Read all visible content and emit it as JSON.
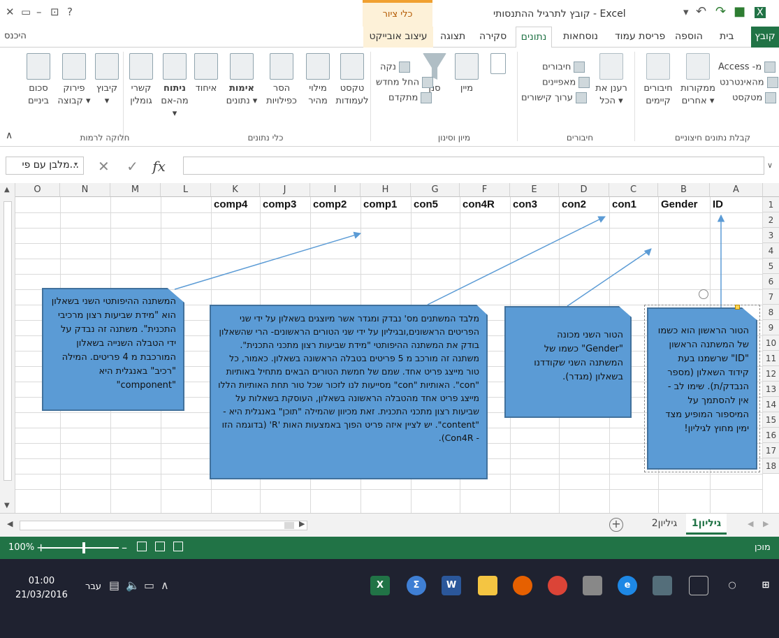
{
  "window": {
    "title": "קובץ לתרגיל ההתנסותי - Excel",
    "context_tool": "כלי ציור",
    "help": "?",
    "signin": "היכנס"
  },
  "tabs": {
    "file": "קובץ",
    "home": "בית",
    "insert": "הוספה",
    "page_layout": "פריסת עמוד",
    "formulas": "נוסחאות",
    "data": "נתונים",
    "review": "סקירה",
    "view": "תצוגה",
    "format": "עיצוב אובייקט"
  },
  "ribbon": {
    "get_external": {
      "label": "קבלת נתונים חיצוניים",
      "access": "Access -מ",
      "web": "מהאינטרנט",
      "text": "מטקסט",
      "other_sources_1": "ממקורות",
      "other_sources_2": "אחרים ▾",
      "existing_1": "חיבורים",
      "existing_2": "קיימים"
    },
    "connections": {
      "label": "חיבורים",
      "refresh_1": "רענן את",
      "refresh_2": "הכל ▾",
      "connections": "חיבורים",
      "properties": "מאפיינים",
      "edit_links": "ערוך קישורים"
    },
    "sort_filter": {
      "label": "מיון וסינון",
      "sort": "מיין",
      "filter": "סנן",
      "clear": "נקה",
      "reapply": "החל מחדש",
      "advanced": "מתקדם"
    },
    "data_tools": {
      "label": "כלי נתונים",
      "text_to_columns_1": "טקסט",
      "text_to_columns_2": "לעמודות",
      "flash_fill_1": "מילוי",
      "flash_fill_2": "מהיר",
      "remove_dup_1": "הסר",
      "remove_dup_2": "כפילויות",
      "validation_1": "אימות",
      "validation_2": "נתונים ▾",
      "consolidate": "איחוד",
      "whatif_1": "ניתוח",
      "whatif_2": "מה-אם ▾",
      "relationships_1": "קשרי",
      "relationships_2": "גומלין"
    },
    "outline": {
      "label": "חלוקה לרמות",
      "group_1": "קיבוץ",
      "group_2": "▾",
      "ungroup_1": "פירוק",
      "ungroup_2": "קבוצה ▾",
      "subtotal_1": "סכום",
      "subtotal_2": "ביניים"
    }
  },
  "formula_bar": {
    "name_box": "מלבן עם פי...",
    "fx": "fx",
    "value": ""
  },
  "columns": [
    "A",
    "B",
    "C",
    "D",
    "E",
    "F",
    "G",
    "H",
    "I",
    "J",
    "K",
    "L",
    "M",
    "N",
    "O"
  ],
  "rows": [
    "1",
    "2",
    "3",
    "4",
    "5",
    "6",
    "7",
    "8",
    "9",
    "10",
    "11",
    "12",
    "13",
    "14",
    "15",
    "16",
    "17",
    "18"
  ],
  "header_cells": {
    "A": "ID",
    "B": "Gender",
    "C": "con1",
    "D": "con2",
    "E": "con3",
    "F": "con4R",
    "G": "con5",
    "H": "comp1",
    "I": "comp2",
    "J": "comp3",
    "K": "comp4"
  },
  "callouts": {
    "id_note": "הטור הראשון הוא כשמו של המשתנה הראשון \"ID\" שרשמנו בעת קידוד השאלון (מספר הנבדק/ת). שימו לב - אין להסתמך על המיספור המופיע מצד ימין מחוץ לגיליון!",
    "gender_note": "הטור השני מכונה \"Gender\" כשמו של המשתנה השני שקודדנו בשאלון (מגדר).",
    "con_note": "מלבד המשתנים מס' נבדק ומגדר אשר מיוצגים בשאלון על ידי שני הפריטים הראשונים,ובגיליון על ידי שני הטורים הראשונים- הרי שהשאלון בודק את המשתנה ההיפותטי \"מידת שביעות רצון מתכני התכנית\". משתנה זה מורכב מ 5 פריטים בטבלה הראשונה בשאלון. כאמור, כל טור מייצג פריט אחד. שמם של חמשת הטורים הבאים מתחיל באותיות \"con\". האותיות \"con\" מסייעות לנו לזכור שכל טור תחת האותיות הללו מייצג פריט אחד מהטבלה הראשונה בשאלון, העוסקת בשאלות על שביעות רצון מתכני התכנית. זאת מכיוון שהמילה \"תוכן\" באנגלית היא - \"content\". יש לציין איזה פריט הפוך באמצעות האות 'R' (בדוגמה הזו - Con4R).",
    "comp_note": "המשתנה ההיפותטי השני בשאלון הוא \"מידת שביעות רצון מרכיבי התכנית\". משתנה זה נבדק על ידי הטבלה השנייה בשאלון המורכבת מ 4 פריטים. המילה \"רכיב\" באנגלית היא \"component\""
  },
  "sheets": {
    "sheet1": "גיליון1",
    "sheet2": "גיליון2",
    "add": "+"
  },
  "status": {
    "ready": "מוכן",
    "zoom": "100%"
  },
  "taskbar": {
    "time": "01:00",
    "date": "21/03/2016",
    "lang": "עבר"
  },
  "colors": {
    "excel_green": "#217346",
    "callout_fill": "#5b9bd5",
    "callout_border": "#41719c",
    "context_tab": "#fdf1d8"
  }
}
